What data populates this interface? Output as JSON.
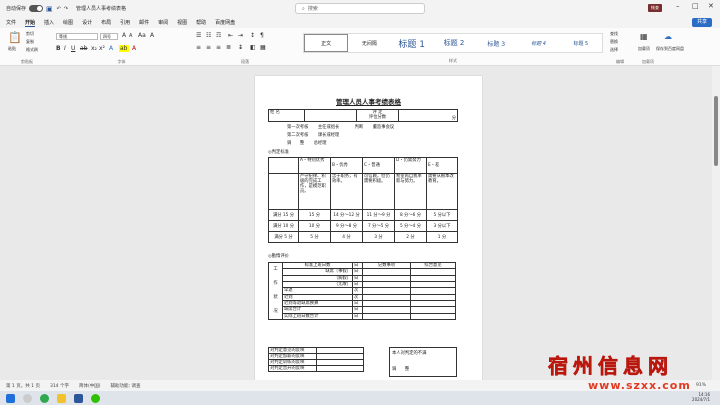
{
  "titlebar": {
    "autosave": "自动保存",
    "doc_name": "管理人员人事考绩表格",
    "search_placeholder": "搜索",
    "user": "帐查",
    "share": "共享"
  },
  "menu": [
    "文件",
    "开始",
    "插入",
    "绘图",
    "设计",
    "布局",
    "引用",
    "邮件",
    "审阅",
    "视图",
    "帮助",
    "百度网盘"
  ],
  "ribbon": {
    "clipboard": {
      "paste": "粘贴",
      "cut": "剪切",
      "copy": "复制",
      "format_painter": "格式刷",
      "label": "剪贴板"
    },
    "font": {
      "name": "等线",
      "size": "四号",
      "label": "字体"
    },
    "paragraph": {
      "label": "段落"
    },
    "styles": {
      "items": [
        "正文",
        "无间隔",
        "标题 1",
        "标题 2",
        "标题 3",
        "标题 4",
        "标题 5"
      ],
      "label": "样式"
    },
    "editing": {
      "find": "查找",
      "replace": "替换",
      "select": "选择",
      "label": "编辑"
    },
    "addins": {
      "addins": "加载项",
      "save_baidu": "保存到百度网盘",
      "label": "加载项",
      "baidu_label": "保存"
    }
  },
  "doc": {
    "title": "管理人员人事考绩表格",
    "header_row": {
      "name": "姓 名",
      "review": "评 定",
      "eval": "评位分数",
      "score": "分"
    },
    "reviewers": [
      {
        "a": "第一次考核",
        "b": "主任或组长",
        "c": "判断",
        "d": "董监事会议"
      },
      {
        "a": "第二次考核",
        "b": "课长或经理"
      },
      {
        "a": "调　　整",
        "b": "总经理"
      }
    ],
    "criteria_heading": "◎判定标准",
    "criteria": {
      "headers": [
        "A・特别优秀",
        "B・优秀",
        "C・普通",
        "D・仍需努力",
        "E・差"
      ],
      "descriptions": [
        "严守纪律、积极的完成工作，是模范职员。",
        "忠于职务，有效率。",
        "可信赖，但仍需要积极。",
        "希望再自我革新与努力。",
        "需要从根本改教育。"
      ],
      "rows": [
        {
          "label": "满分 15 分",
          "cells": [
            "15 分",
            "14 分～12 分",
            "11 分～9 分",
            "8 分～6 分",
            "5 分以下"
          ]
        },
        {
          "label": "满分 10 分",
          "cells": [
            "10 分",
            "9 分～8 分",
            "7 分～5 分",
            "5 分～4 分",
            "3 分以下"
          ]
        },
        {
          "label": "满分 5 分",
          "cells": [
            "5 分",
            "4 分",
            "3 分",
            "2 分",
            "1 分"
          ]
        }
      ]
    },
    "work_heading": "◎勤惰评价",
    "work": {
      "side": [
        "工",
        "作",
        "状",
        "况"
      ],
      "col_headers": [
        "标准上班日数",
        "日",
        "记数事项",
        "综合意见"
      ],
      "rows": [
        {
          "label": "缺席（事假）",
          "unit": "日"
        },
        {
          "label": "（病假）",
          "unit": "日"
        },
        {
          "label": "（无故）",
          "unit": "日"
        },
        {
          "label": "早退",
          "unit": "次"
        },
        {
          "label": "迟到",
          "unit": "次"
        },
        {
          "label": "迟到等退缺席换算",
          "unit": "日"
        },
        {
          "label": "缺席合计",
          "unit": "日"
        },
        {
          "label": "实际上班日数合计",
          "unit": "日"
        }
      ]
    },
    "bottom_left": [
      "对判定意见的反映",
      "对判定加薪的反映",
      "对判定训练的反映",
      "对判定晋升的反映"
    ],
    "bottom_right": {
      "line1": "本人对判定的不满",
      "line2": "调　　整"
    }
  },
  "status": {
    "page": "第 1 页，共 1 页",
    "words": "314 个字",
    "lang": "简体(中国)",
    "accessibility": "辅助功能: 调查",
    "zoom": "91%"
  },
  "watermark": {
    "line1": "宿州信息网",
    "line2": "www.szxx.com"
  },
  "clock": {
    "time": "14:16",
    "date": "2024/7/1"
  }
}
